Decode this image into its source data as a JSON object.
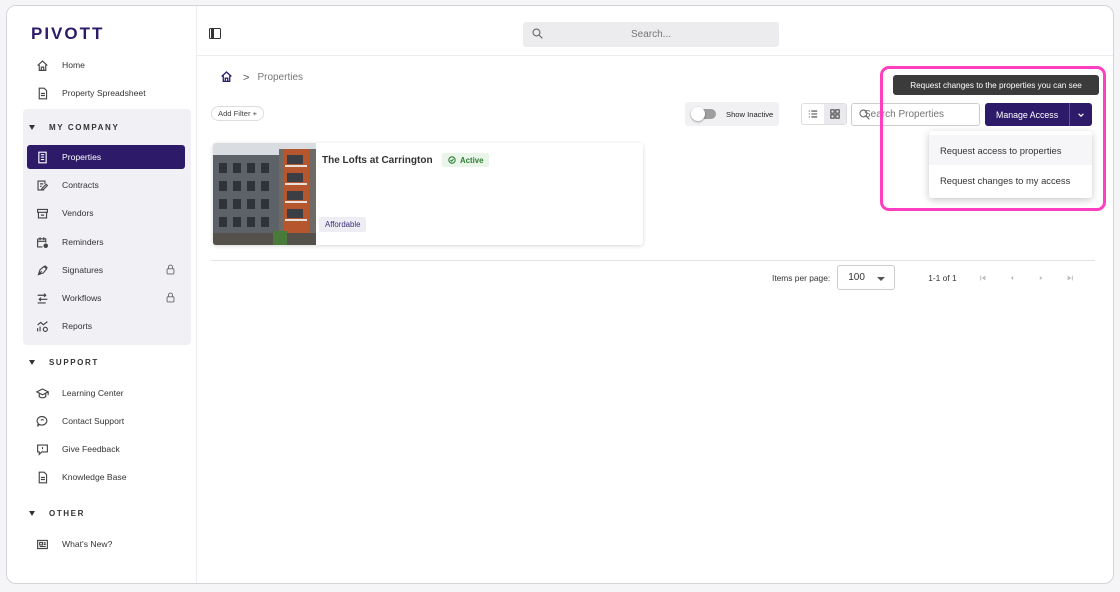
{
  "app": {
    "logo": "PIVOTT"
  },
  "sidebar": {
    "top_items": [
      {
        "label": "Home",
        "icon": "home-icon"
      },
      {
        "label": "Property Spreadsheet",
        "icon": "document-icon"
      }
    ],
    "sections": [
      {
        "title": "MY COMPANY",
        "items": [
          {
            "label": "Properties",
            "icon": "building-icon",
            "active": true
          },
          {
            "label": "Contracts",
            "icon": "contract-icon"
          },
          {
            "label": "Vendors",
            "icon": "storefront-icon"
          },
          {
            "label": "Reminders",
            "icon": "calendar-clock-icon"
          },
          {
            "label": "Signatures",
            "icon": "pen-nib-icon",
            "locked": true
          },
          {
            "label": "Workflows",
            "icon": "workflow-icon",
            "locked": true
          },
          {
            "label": "Reports",
            "icon": "chart-icon"
          }
        ]
      },
      {
        "title": "SUPPORT",
        "items": [
          {
            "label": "Learning Center",
            "icon": "graduation-cap-icon"
          },
          {
            "label": "Contact Support",
            "icon": "chat-bubble-icon"
          },
          {
            "label": "Give Feedback",
            "icon": "feedback-icon"
          },
          {
            "label": "Knowledge Base",
            "icon": "document-icon"
          }
        ]
      },
      {
        "title": "OTHER",
        "items": [
          {
            "label": "What's New?",
            "icon": "newspaper-icon"
          }
        ]
      }
    ]
  },
  "topbar": {
    "search_placeholder": "Search..."
  },
  "breadcrumb": {
    "current": "Properties",
    "separator": ">"
  },
  "toolbar": {
    "add_filter": "Add Filter +",
    "show_inactive": "Show Inactive",
    "show_inactive_on": false,
    "search_placeholder": "Search Properties",
    "manage_access": "Manage Access"
  },
  "tooltip": "Request changes to the properties you can see",
  "dropdown": {
    "items": [
      "Request access to properties",
      "Request changes to my access"
    ]
  },
  "properties": [
    {
      "name": "The Lofts at Carrington",
      "status": "Active",
      "tag": "Affordable"
    }
  ],
  "pagination": {
    "items_per_page_label": "Items per page:",
    "items_per_page": "100",
    "range": "1-1 of 1"
  },
  "colors": {
    "brand": "#2d1b69",
    "highlight": "#ff3fc0",
    "active_status": "#2e7d32"
  }
}
